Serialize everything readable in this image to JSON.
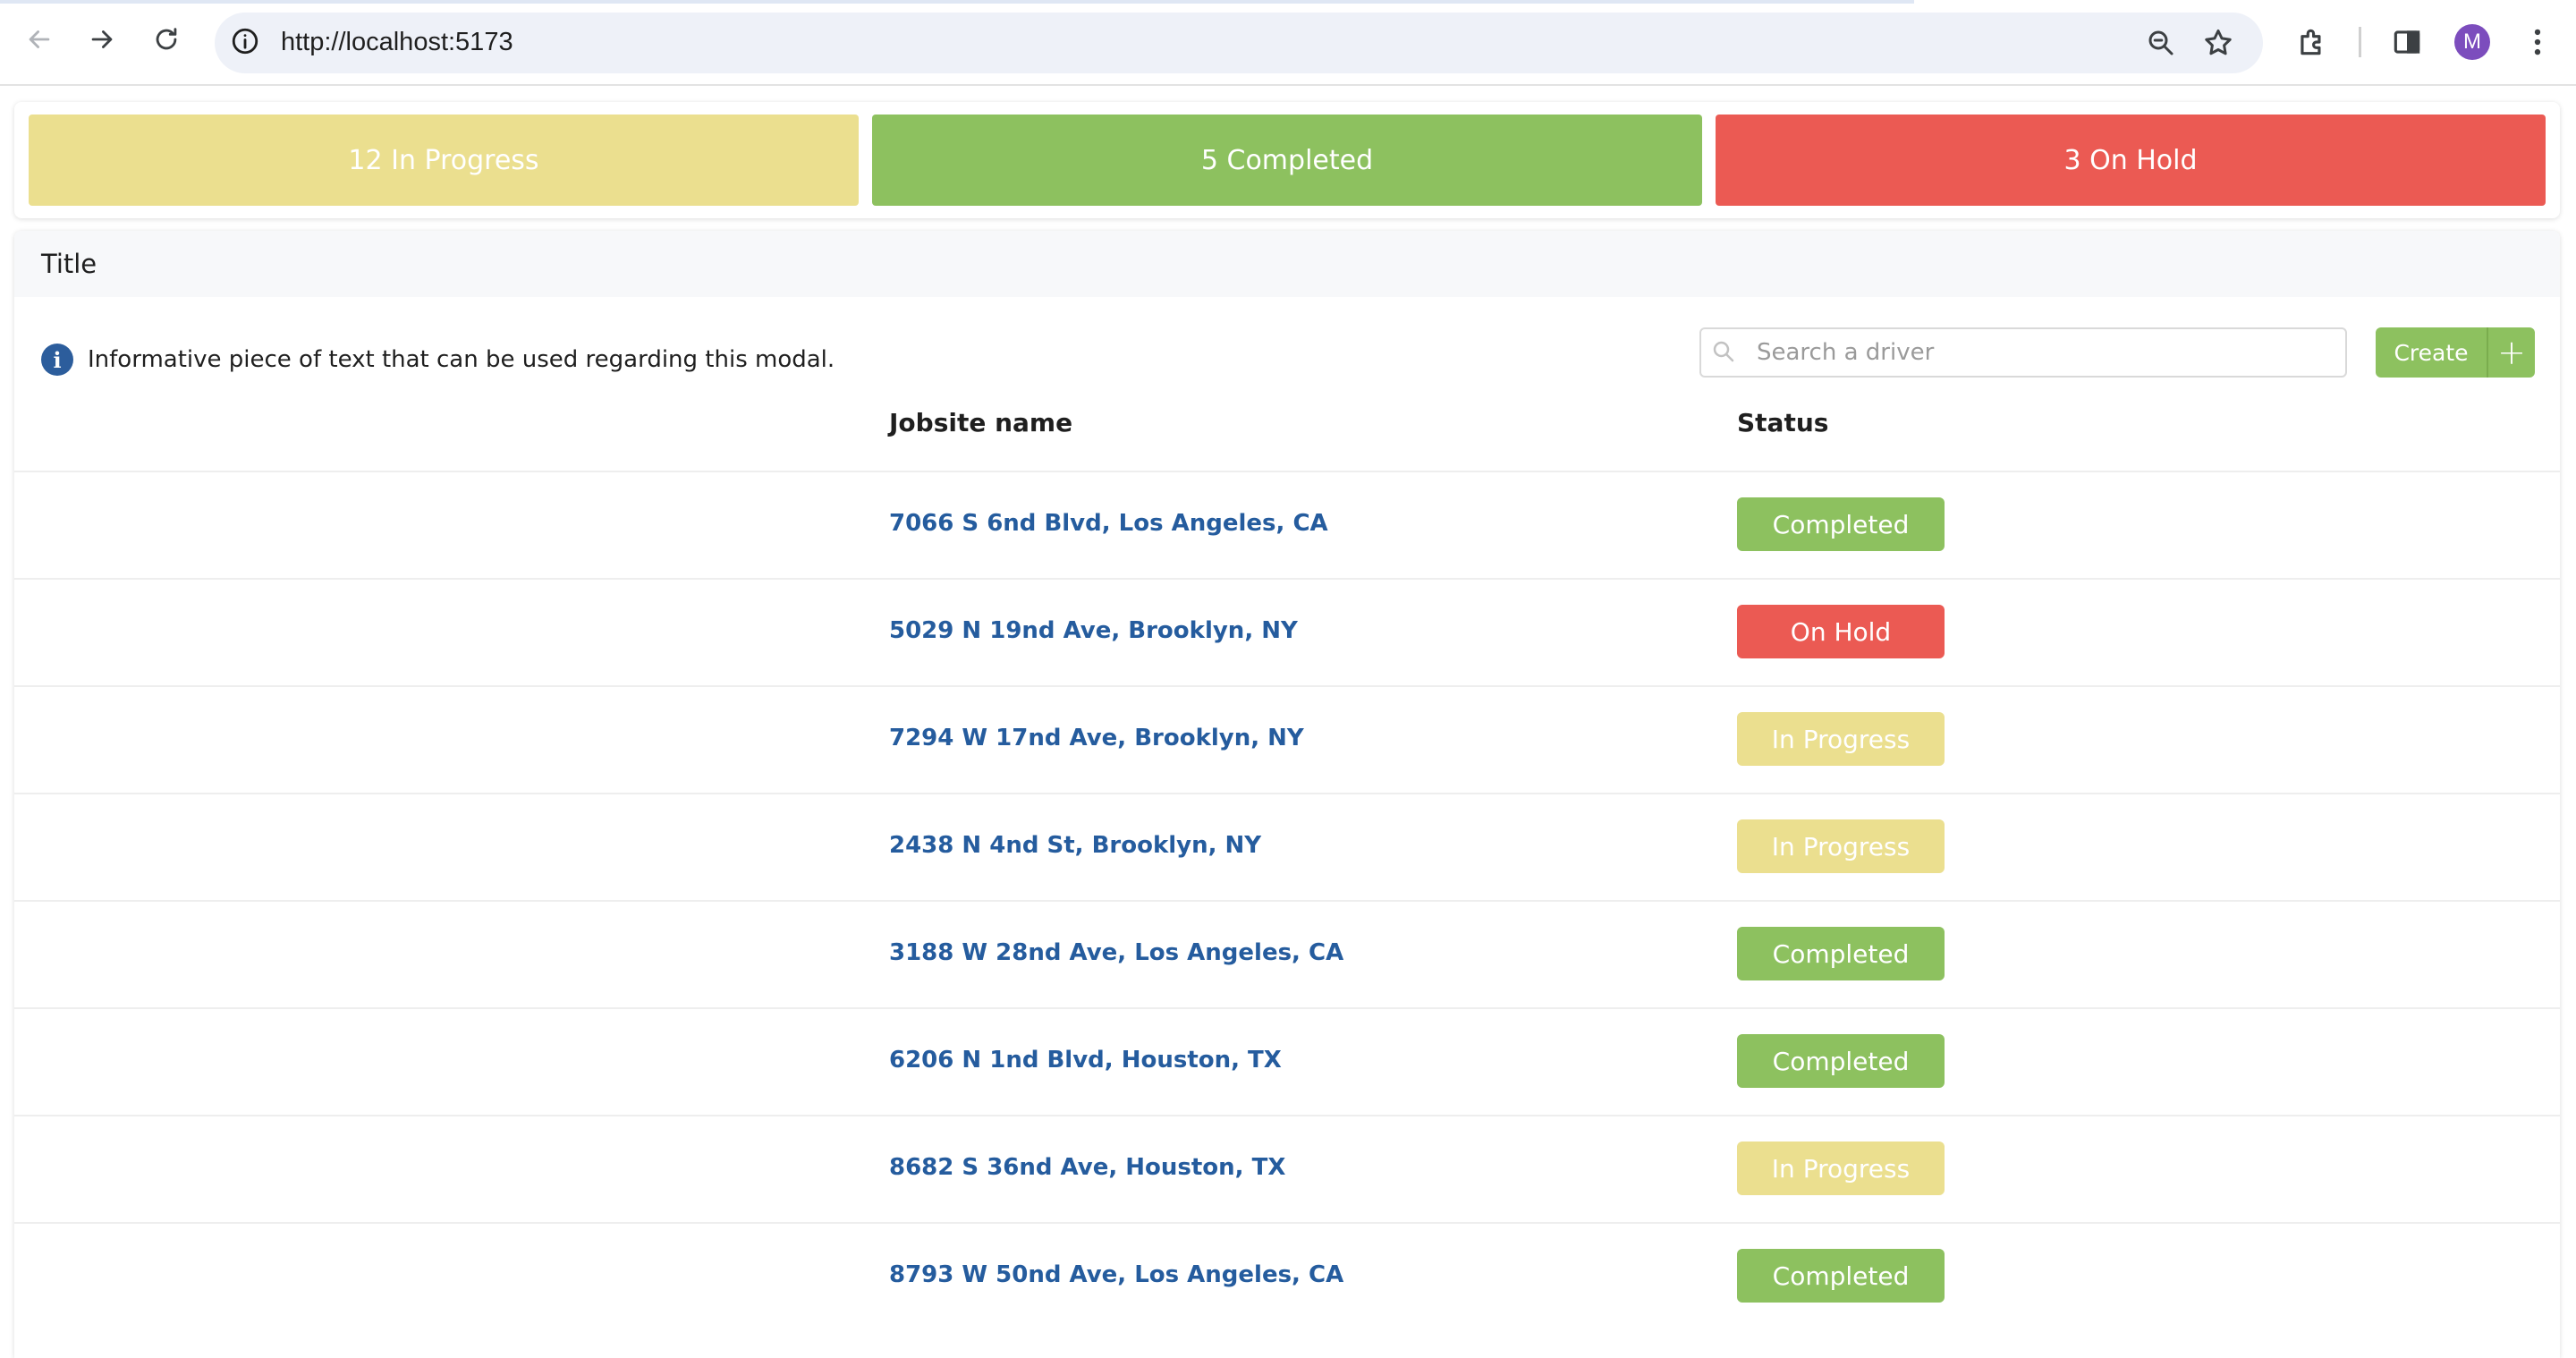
{
  "browser": {
    "url": "http://localhost:5173",
    "profile_initial": "M",
    "icons": {
      "back": "arrow-left-icon",
      "forward": "arrow-right-icon",
      "reload": "reload-icon",
      "site_info": "info-circle-icon",
      "zoom": "magnifier-icon",
      "bookmark": "star-icon",
      "extensions": "puzzle-icon",
      "side_panel": "side-panel-icon",
      "menu": "kebab-menu-icon"
    }
  },
  "summary": {
    "in_progress": "12 In Progress",
    "completed": "5 Completed",
    "on_hold": "3 On Hold"
  },
  "panel": {
    "title": "Title",
    "info_text": "Informative piece of text that can be used regarding this modal.",
    "search_placeholder": "Search a driver",
    "create_label": "Create",
    "create_plus": "+"
  },
  "table": {
    "columns": [
      "Jobsite name",
      "Status"
    ],
    "rows": [
      {
        "jobsite": "7066 S 6nd Blvd, Los Angeles, CA",
        "status": "Completed"
      },
      {
        "jobsite": "5029 N 19nd Ave, Brooklyn, NY",
        "status": "On Hold"
      },
      {
        "jobsite": "7294 W 17nd Ave, Brooklyn, NY",
        "status": "In Progress"
      },
      {
        "jobsite": "2438 N 4nd St, Brooklyn, NY",
        "status": "In Progress"
      },
      {
        "jobsite": "3188 W 28nd Ave, Los Angeles, CA",
        "status": "Completed"
      },
      {
        "jobsite": "6206 N 1nd Blvd, Houston, TX",
        "status": "Completed"
      },
      {
        "jobsite": "8682 S 36nd Ave, Houston, TX",
        "status": "In Progress"
      },
      {
        "jobsite": "8793 W 50nd Ave, Los Angeles, CA",
        "status": "Completed"
      }
    ]
  },
  "colors": {
    "in_progress": "#ebdf8f",
    "completed": "#8dc15f",
    "on_hold": "#eb5a53",
    "link": "#255c9e",
    "info_icon": "#2c5d9c"
  }
}
